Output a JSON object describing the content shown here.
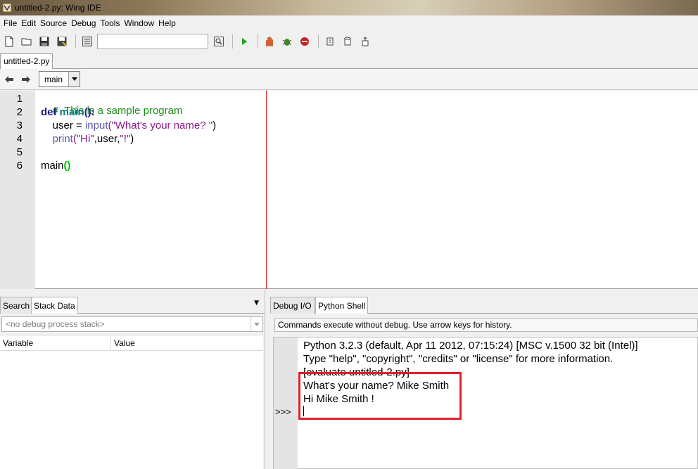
{
  "window": {
    "title": "untitled-2.py: Wing IDE"
  },
  "menu": [
    "File",
    "Edit",
    "Source",
    "Debug",
    "Tools",
    "Window",
    "Help"
  ],
  "toolbar": {
    "search_value": "",
    "buttons": [
      "new-file-icon",
      "open-file-icon",
      "save-icon",
      "save-all-icon",
      "indent-icon",
      "search-go-icon",
      "run-icon",
      "stop-hand-icon",
      "debug-bug-icon",
      "abort-icon",
      "step-into-icon",
      "step-over-icon",
      "step-out-icon"
    ]
  },
  "editor": {
    "tab_label": "untitled-2.py",
    "scope": "main",
    "line_numbers": [
      "1",
      "2",
      "3",
      "4",
      "5",
      "6"
    ],
    "lines": [
      {
        "comment": "#  This is a sample program"
      },
      {
        "kw": "def ",
        "name": "main",
        "rest": "():"
      },
      {
        "indent": "    ",
        "var": "user = ",
        "builtin": "input",
        "open": "(",
        "str": "\"What's your name? \"",
        "close": ")"
      },
      {
        "indent": "    ",
        "builtin": "print",
        "open": "(",
        "str1": "\"Hi\"",
        "mid": ",user,",
        "str2": "\"!\"",
        "close": ")"
      },
      {},
      {
        "call": "main",
        "parens": "()"
      }
    ]
  },
  "left_panel": {
    "tabs": [
      "Search",
      "Stack Data"
    ],
    "active_tab": "Stack Data",
    "stack_placeholder": "<no debug process stack>",
    "columns": [
      "Variable",
      "Value"
    ]
  },
  "right_panel": {
    "tabs": [
      "Debug I/O",
      "Python Shell"
    ],
    "active_tab": "Python Shell",
    "info": "Commands execute without debug.  Use arrow keys for history.",
    "prompt": ">>>",
    "output": [
      "Python 3.2.3 (default, Apr 11 2012, 07:15:24) [MSC v.1500 32 bit (Intel)]",
      "Type \"help\", \"copyright\", \"credits\" or \"license\" for more information.",
      "[evaluate untitled-2.py]",
      "What's your name? Mike Smith",
      "Hi Mike Smith !"
    ]
  },
  "colors": {
    "highlight": "#e0202a",
    "edge": "#e02020"
  }
}
